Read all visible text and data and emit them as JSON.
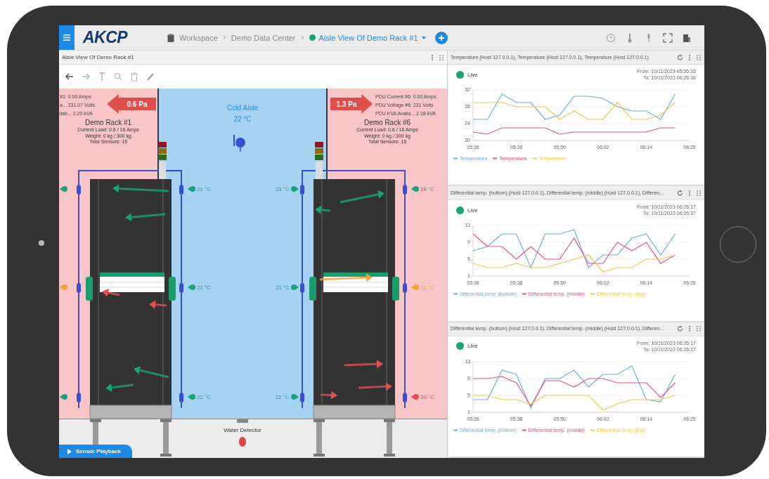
{
  "top_bar": {
    "logo": "AKCP",
    "breadcrumbs": [
      {
        "label": "Workspace",
        "current": false
      },
      {
        "label": "Demo Data Center",
        "current": false
      },
      {
        "label": "Aisle View Of Demo Rack #1",
        "current": true
      }
    ]
  },
  "aisle_panel": {
    "title": "Aisle View Of Demo Rack #1",
    "cold_aisle": {
      "label": "Cold Aisle",
      "reading": "22 °C"
    },
    "pressure": [
      {
        "kind": "left",
        "reading": "0.6 Pa"
      },
      {
        "kind": "right",
        "reading": "1.3 Pa"
      }
    ],
    "side_info_left": [
      "#1: 0.00 Amps",
      "a... 231.07 Volts",
      "ilab... 2.20 kVA"
    ],
    "side_info_right": [
      "PDU Current #6: 0.00 Amps",
      "PDU Voltage #6: 231 Volts",
      "PDU KVA Availa... 2.18 kVA"
    ],
    "racks": [
      {
        "name": "Demo Rack #1",
        "details": [
          "Current Load: 0.6 / 16 Amps",
          "Weight: 0 kg / 300 kg",
          "Total Sensors: 15"
        ]
      },
      {
        "name": "Demo Rack #6",
        "details": [
          "Current Load: 0.6 / 16 Amps",
          "Weight: 0 kg / 300 kg",
          "Total Sensors: 15"
        ]
      }
    ],
    "sensors": [
      {
        "color": "#1aa37a"
      },
      {
        "color": "#f0a53a"
      },
      {
        "color": "#1aa37a"
      },
      {
        "reading": "21 °C",
        "color": "#1aa37a"
      },
      {
        "reading": "21 °C",
        "color": "#1aa37a"
      },
      {
        "reading": "22 °C",
        "color": "#1aa37a"
      },
      {
        "reading": "23 °C",
        "color": "#1aa37a"
      },
      {
        "reading": "21 °C",
        "color": "#1aa37a"
      },
      {
        "reading": "22 °C",
        "color": "#1aa37a"
      },
      {
        "reading": "28 °C",
        "color": "#1aa37a"
      },
      {
        "reading": "31 °C",
        "color": "#f0a53a"
      },
      {
        "reading": "30 °C",
        "color": "#e0514d"
      }
    ],
    "water_detector": {
      "label": "Water Detector"
    },
    "playback_button": "Sensor Playback"
  },
  "widgets": [
    {
      "title": "Temperature (Host 127.0.0.1), Temperature (Host 127.0.0.1), Temperature (Host 127.0.0.1)",
      "status": "Live",
      "from": "From: 10/11/2023 05:26:16",
      "to": "To: 10/11/2023 06:26:16",
      "chart_data": {
        "type": "line",
        "categories": [
          "05:26",
          null,
          null,
          "05:38",
          null,
          null,
          "05:50",
          null,
          null,
          "06:02",
          null,
          null,
          "06:14",
          null,
          null,
          "06:25"
        ],
        "ylim": [
          20,
          32
        ],
        "yticks": [
          20,
          24,
          28,
          32
        ],
        "series": [
          {
            "name": "Temperature",
            "color": "#6aaee8",
            "values": [
              25,
              25,
              31,
              29,
              29,
              25,
              26,
              30.5,
              30.5,
              30,
              28,
              27,
              27,
              25,
              31,
              null
            ]
          },
          {
            "name": "Temperature",
            "color": "#e8508a",
            "values": [
              22,
              21.5,
              23,
              23,
              23,
              23,
              21.5,
              22,
              22,
              22,
              22,
              22,
              22,
              23,
              23,
              null
            ]
          },
          {
            "name": "Temperature",
            "color": "#f5c842",
            "values": [
              29,
              29,
              29,
              28,
              28,
              28,
              25,
              27,
              25,
              25,
              29,
              25,
              25,
              26,
              29,
              null
            ]
          }
        ]
      }
    },
    {
      "title": "Differential temp. (bottom) (Host 127.0.0.1), Differential temp. (middle) (Host 127.0.0.1), Differen...",
      "status": "Live",
      "from": "From: 10/11/2023 06:26:17",
      "to": "To: 10/11/2023 06:26:17",
      "chart_data": {
        "type": "line",
        "categories": [
          "05:26",
          null,
          null,
          "05:38",
          null,
          null,
          "05:50",
          null,
          null,
          "06:02",
          null,
          null,
          "06:14",
          null,
          null,
          "06:25"
        ],
        "ylim": [
          1,
          13
        ],
        "yticks": [
          1,
          5,
          9,
          13
        ],
        "series": [
          {
            "name": "Differential temp. (bottom)",
            "color": "#6aaee8",
            "values": [
              7,
              8,
              11,
              11,
              3,
              11,
              11,
              12,
              3,
              6,
              6,
              10,
              11,
              6,
              11,
              null
            ]
          },
          {
            "name": "Differential temp. (middle)",
            "color": "#e8508a",
            "values": [
              11,
              8,
              8,
              5,
              8,
              5,
              5,
              10,
              4,
              4,
              9,
              7,
              9,
              4,
              6,
              null
            ]
          },
          {
            "name": "Differential temp. (top)",
            "color": "#f5c842",
            "values": [
              4,
              3,
              3,
              4,
              3,
              3,
              4,
              5,
              6,
              2,
              3,
              3,
              5,
              5,
              6,
              null
            ]
          }
        ]
      }
    },
    {
      "title": "Differential temp. (bottom) (Host 127.0.0.1), Differential temp. (middle) (Host 127.0.0.1), Differen...",
      "status": "Live",
      "from": "From: 10/11/2023 06:26:17",
      "to": "To: 10/11/2023 06:26:17",
      "chart_data": {
        "type": "line",
        "categories": [
          "05:26",
          null,
          null,
          "05:38",
          null,
          null,
          "05:50",
          null,
          null,
          "06:02",
          null,
          null,
          "06:14",
          null,
          null,
          "06:25"
        ],
        "ylim": [
          1,
          13
        ],
        "yticks": [
          1,
          5,
          9,
          13
        ],
        "series": [
          {
            "name": "Differential temp. (bottom)",
            "color": "#6aaee8",
            "values": [
              4,
              4,
              11,
              10,
              2,
              9,
              9,
              11,
              7,
              10,
              10,
              12,
              4,
              3.5,
              10,
              null
            ]
          },
          {
            "name": "Differential temp. (middle)",
            "color": "#e8508a",
            "values": [
              9,
              9,
              9.5,
              8,
              2.5,
              8.5,
              8.5,
              7,
              9,
              9,
              8,
              8,
              8,
              4.5,
              8,
              null
            ]
          },
          {
            "name": "Differential temp. (top)",
            "color": "#f5c842",
            "values": [
              5,
              5,
              4,
              4,
              3,
              5,
              5,
              5,
              5,
              1.5,
              3,
              4,
              4,
              4,
              5,
              null
            ]
          }
        ]
      }
    }
  ]
}
